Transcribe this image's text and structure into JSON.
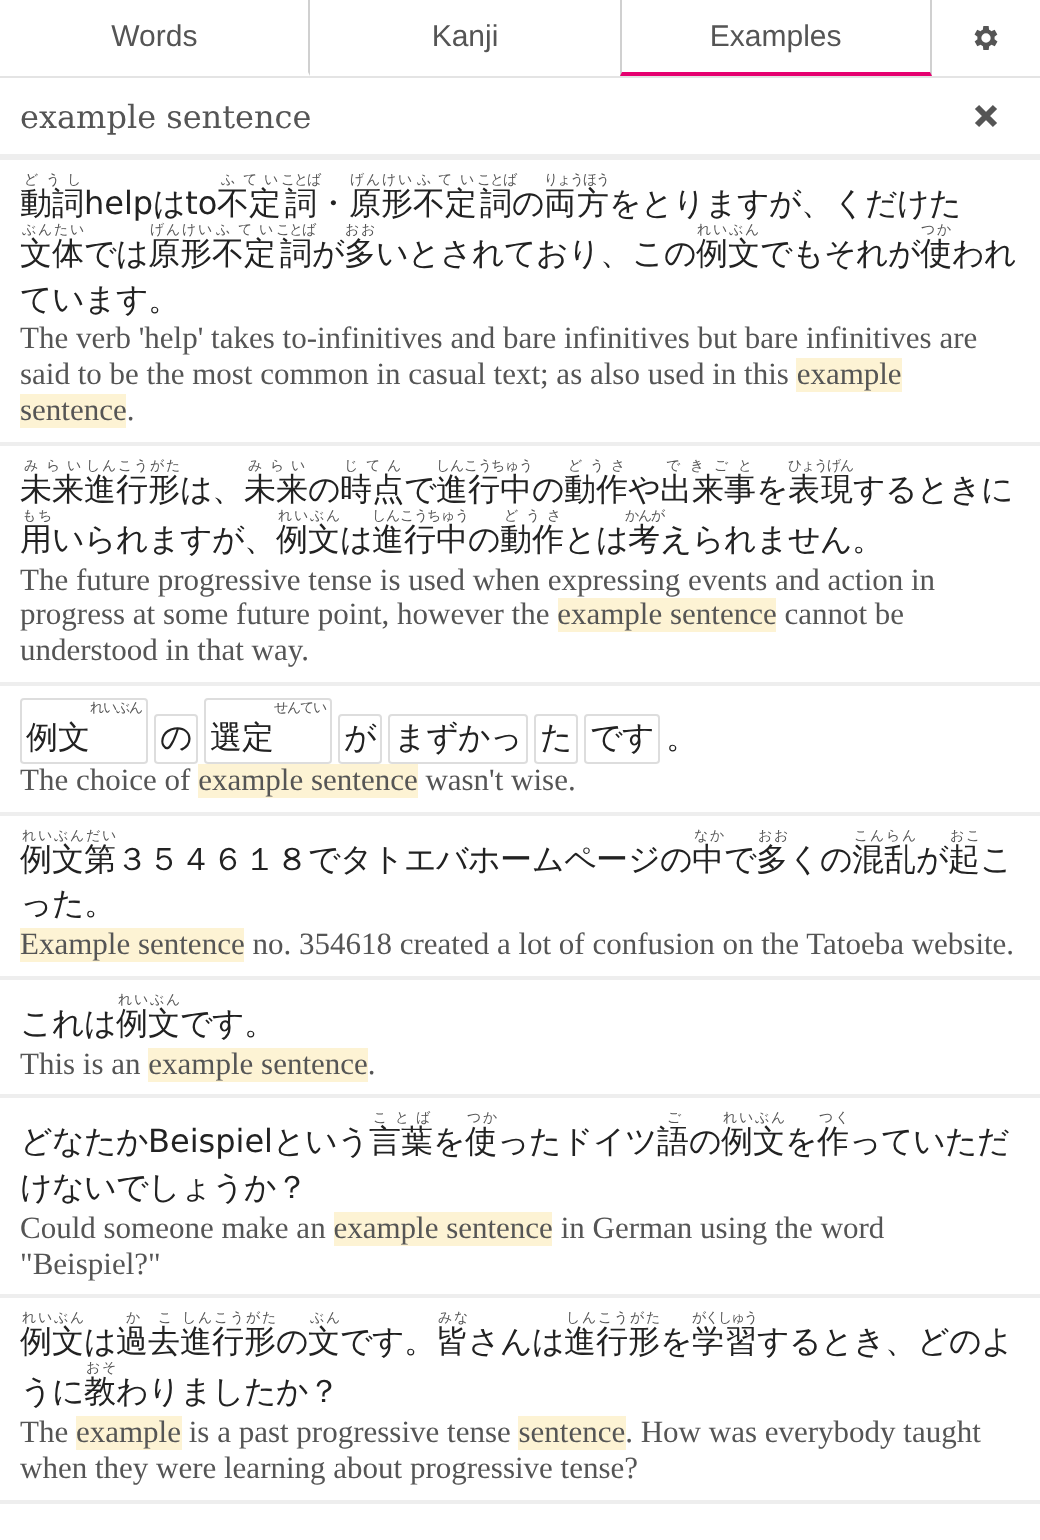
{
  "tabs": [
    {
      "label": "Words",
      "selected": false
    },
    {
      "label": "Kanji",
      "selected": false
    },
    {
      "label": "Examples",
      "selected": true
    }
  ],
  "search": {
    "value": "example sentence"
  },
  "examples": [
    {
      "japanese": [
        {
          "text": "動詞",
          "ruby": "どうし"
        },
        {
          "text": "helpはto"
        },
        {
          "text": "不定",
          "ruby": "ふてい"
        },
        {
          "text": "詞",
          "ruby": "ことば"
        },
        {
          "text": "・"
        },
        {
          "text": "原形",
          "ruby": "げんけい"
        },
        {
          "text": "不定",
          "ruby": "ふてい"
        },
        {
          "text": "詞",
          "ruby": "ことば"
        },
        {
          "text": "の"
        },
        {
          "text": "両方",
          "ruby": "りょうほう"
        },
        {
          "text": "をとりますが、くだけた"
        },
        {
          "text": "文体",
          "ruby": "ぶんたい"
        },
        {
          "text": "では"
        },
        {
          "text": "原形",
          "ruby": "げんけい"
        },
        {
          "text": "不定",
          "ruby": "ふてい"
        },
        {
          "text": "詞",
          "ruby": "ことば"
        },
        {
          "text": "が"
        },
        {
          "text": "多",
          "ruby": "おお"
        },
        {
          "text": "いとされており、この"
        },
        {
          "text": "例文",
          "ruby": "れいぶん"
        },
        {
          "text": "でもそれが"
        },
        {
          "text": "使",
          "ruby": "つか"
        },
        {
          "text": "われています。"
        }
      ],
      "english": [
        {
          "text": "The verb 'help' takes to-infinitives and bare infinitives but bare infinitives are said to be the most common in casual text; as also used in this ",
          "highlight": false
        },
        {
          "text": "example sentence",
          "highlight": true
        },
        {
          "text": ".",
          "highlight": false
        }
      ]
    },
    {
      "japanese": [
        {
          "text": "未来",
          "ruby": "みらい"
        },
        {
          "text": "進行形",
          "ruby": "しんこうがた"
        },
        {
          "text": "は、"
        },
        {
          "text": "未来",
          "ruby": "みらい"
        },
        {
          "text": "の"
        },
        {
          "text": "時点",
          "ruby": "じてん"
        },
        {
          "text": "で"
        },
        {
          "text": "進行中",
          "ruby": "しんこうちゅう"
        },
        {
          "text": "の"
        },
        {
          "text": "動作",
          "ruby": "どうさ"
        },
        {
          "text": "や"
        },
        {
          "text": "出来事",
          "ruby": "できごと"
        },
        {
          "text": "を"
        },
        {
          "text": "表現",
          "ruby": "ひょうげん"
        },
        {
          "text": "するときに"
        },
        {
          "text": "用",
          "ruby": "もち"
        },
        {
          "text": "いられますが、"
        },
        {
          "text": "例文",
          "ruby": "れいぶん"
        },
        {
          "text": "は"
        },
        {
          "text": "進行中",
          "ruby": "しんこうちゅう"
        },
        {
          "text": "の"
        },
        {
          "text": "動作",
          "ruby": "どうさ"
        },
        {
          "text": "とは"
        },
        {
          "text": "考",
          "ruby": "かんが"
        },
        {
          "text": "えられません。"
        }
      ],
      "english": [
        {
          "text": "The future progressive tense is used when expressing events and action in progress at some future point, however the ",
          "highlight": false
        },
        {
          "text": "example sentence",
          "highlight": true
        },
        {
          "text": " cannot be understood in that way.",
          "highlight": false
        }
      ]
    },
    {
      "japanese": [
        {
          "text": "例文",
          "ruby": "れいぶん",
          "boxed": true
        },
        {
          "text": "の",
          "boxed": true
        },
        {
          "text": "選定",
          "ruby": "せんてい",
          "boxed": true
        },
        {
          "text": "が",
          "boxed": true
        },
        {
          "text": "まずかっ",
          "boxed": true
        },
        {
          "text": "た",
          "boxed": true
        },
        {
          "text": "です",
          "boxed": true
        },
        {
          "text": "。",
          "boxed": false
        }
      ],
      "english": [
        {
          "text": "The choice of ",
          "highlight": false
        },
        {
          "text": "example sentence",
          "highlight": true
        },
        {
          "text": " wasn't wise.",
          "highlight": false
        }
      ]
    },
    {
      "japanese": [
        {
          "text": "例文第",
          "ruby": "れいぶんだい"
        },
        {
          "text": "３５４６１８でタトエバホームページの"
        },
        {
          "text": "中",
          "ruby": "なか"
        },
        {
          "text": "で"
        },
        {
          "text": "多",
          "ruby": "おお"
        },
        {
          "text": "くの"
        },
        {
          "text": "混乱",
          "ruby": "こんらん"
        },
        {
          "text": "が"
        },
        {
          "text": "起",
          "ruby": "おこ"
        },
        {
          "text": "こった。"
        }
      ],
      "english": [
        {
          "text": "Example sentence",
          "highlight": true
        },
        {
          "text": " no. 354618 created a lot of confusion on the Tatoeba website.",
          "highlight": false
        }
      ]
    },
    {
      "japanese": [
        {
          "text": "これは"
        },
        {
          "text": "例文",
          "ruby": "れいぶん"
        },
        {
          "text": "です。"
        }
      ],
      "english": [
        {
          "text": "This is an ",
          "highlight": false
        },
        {
          "text": "example sentence",
          "highlight": true
        },
        {
          "text": ".",
          "highlight": false
        }
      ]
    },
    {
      "japanese": [
        {
          "text": "どなたかBeispielという"
        },
        {
          "text": "言葉",
          "ruby": "ことば"
        },
        {
          "text": "を"
        },
        {
          "text": "使",
          "ruby": "つか"
        },
        {
          "text": "ったドイツ"
        },
        {
          "text": "語",
          "ruby": "ご"
        },
        {
          "text": "の"
        },
        {
          "text": "例文",
          "ruby": "れいぶん"
        },
        {
          "text": "を"
        },
        {
          "text": "作",
          "ruby": "つく"
        },
        {
          "text": "っていただけないでしょうか？"
        }
      ],
      "english": [
        {
          "text": "Could someone make an ",
          "highlight": false
        },
        {
          "text": "example sentence",
          "highlight": true
        },
        {
          "text": " in German using the word \"Beispiel?\"",
          "highlight": false
        }
      ]
    },
    {
      "japanese": [
        {
          "text": "例文",
          "ruby": "れいぶん"
        },
        {
          "text": "は"
        },
        {
          "text": "過去",
          "ruby": "かこ"
        },
        {
          "text": "進行形",
          "ruby": "しんこうがた"
        },
        {
          "text": "の"
        },
        {
          "text": "文",
          "ruby": "ぶん"
        },
        {
          "text": "です。"
        },
        {
          "text": "皆",
          "ruby": "みな"
        },
        {
          "text": "さんは"
        },
        {
          "text": "進行形",
          "ruby": "しんこうがた"
        },
        {
          "text": "を"
        },
        {
          "text": "学習",
          "ruby": "がくしゅう"
        },
        {
          "text": "するとき、どのように"
        },
        {
          "text": "教",
          "ruby": "おそ"
        },
        {
          "text": "わりましたか？"
        }
      ],
      "english": [
        {
          "text": "The ",
          "highlight": false
        },
        {
          "text": "example",
          "highlight": true
        },
        {
          "text": " is a past progressive tense ",
          "highlight": false
        },
        {
          "text": "sentence",
          "highlight": true
        },
        {
          "text": ". How was everybody taught when they were learning about progressive tense?",
          "highlight": false
        }
      ]
    }
  ]
}
